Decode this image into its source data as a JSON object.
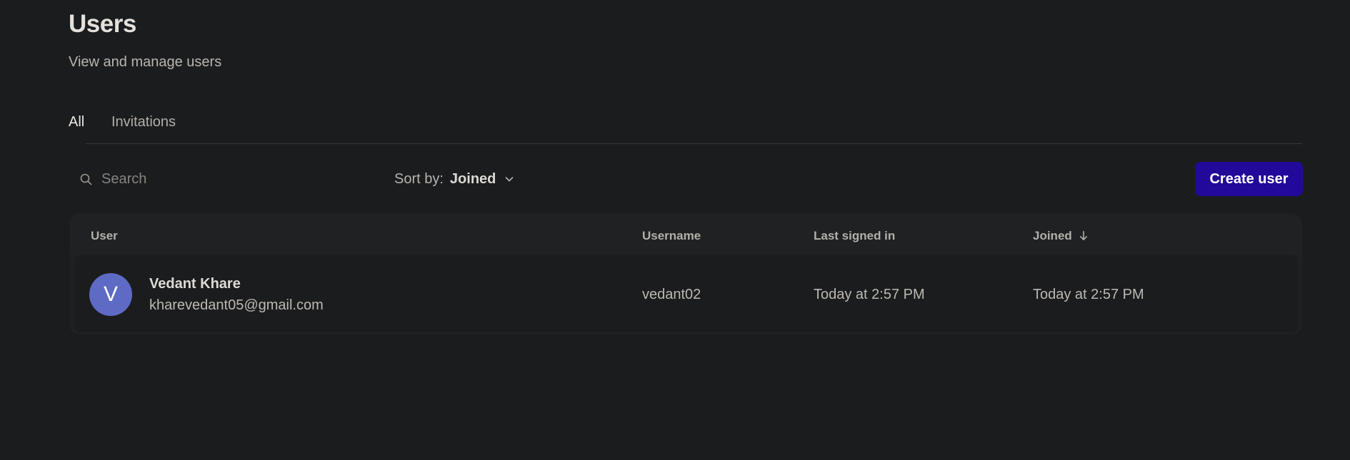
{
  "header": {
    "title": "Users",
    "subtitle": "View and manage users"
  },
  "tabs": [
    {
      "label": "All",
      "active": true
    },
    {
      "label": "Invitations",
      "active": false
    }
  ],
  "toolbar": {
    "search_placeholder": "Search",
    "search_value": "",
    "sort_label": "Sort by:",
    "sort_value": "Joined",
    "create_button_label": "Create user"
  },
  "table": {
    "columns": {
      "user": "User",
      "username": "Username",
      "last_signed_in": "Last signed in",
      "joined": "Joined"
    },
    "sort_direction": "descending",
    "rows": [
      {
        "avatar_initial": "V",
        "name": "Vedant Khare",
        "email": "kharevedant05@gmail.com",
        "username": "vedant02",
        "last_signed_in": "Today at 2:57 PM",
        "joined": "Today at 2:57 PM"
      }
    ]
  },
  "colors": {
    "background": "#1b1c1e",
    "accent_button": "#23099a",
    "avatar": "#5e6bc4"
  },
  "icons": {
    "search": "search-icon",
    "sort_dropdown": "chevron-down-icon",
    "sort_direction": "arrow-down-icon"
  }
}
